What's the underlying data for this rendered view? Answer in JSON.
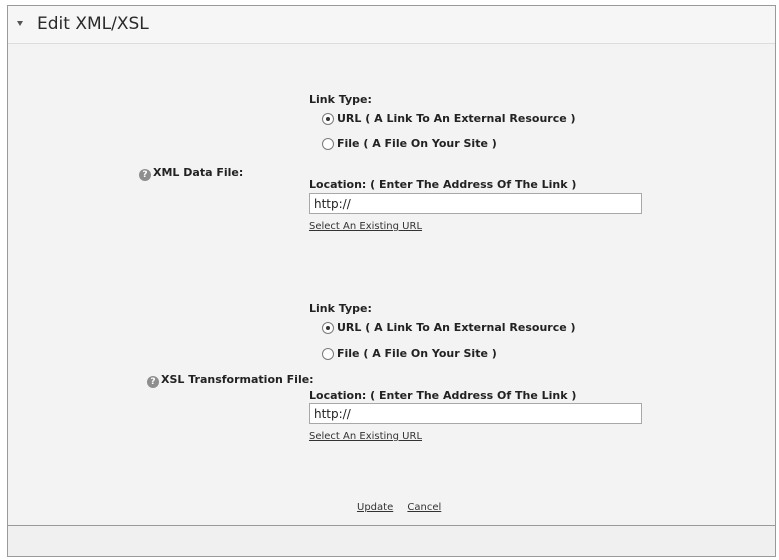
{
  "header": {
    "title": "Edit XML/XSL",
    "collapse_icon": "caret-down-icon"
  },
  "xml": {
    "label": "XML Data File:",
    "link_type_label": "Link Type:",
    "options": [
      {
        "label": "URL ( A Link To An External Resource )",
        "checked": true
      },
      {
        "label": "File ( A File On Your Site )",
        "checked": false
      }
    ],
    "location_label": "Location: ( Enter The Address Of The Link )",
    "location_value": "http://",
    "select_existing": "Select An Existing URL"
  },
  "xsl": {
    "label": "XSL Transformation File:",
    "link_type_label": "Link Type:",
    "options": [
      {
        "label": "URL ( A Link To An External Resource )",
        "checked": true
      },
      {
        "label": "File ( A File On Your Site )",
        "checked": false
      }
    ],
    "location_label": "Location: ( Enter The Address Of The Link )",
    "location_value": "http://",
    "select_existing": "Select An Existing URL"
  },
  "actions": {
    "update": "Update",
    "cancel": "Cancel"
  },
  "icons": {
    "help": "help-icon",
    "radio": "radio-button"
  }
}
